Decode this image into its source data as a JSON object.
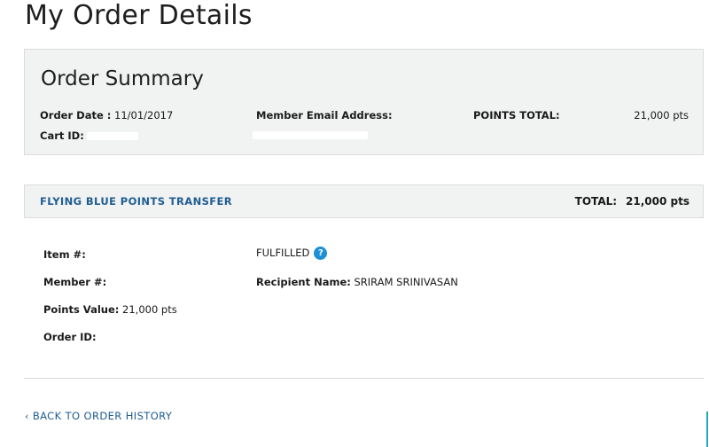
{
  "page": {
    "title": "My Order Details"
  },
  "summary": {
    "title": "Order Summary",
    "order_date_label": "Order Date :",
    "order_date_value": "11/01/2017",
    "cart_id_label": "Cart ID:",
    "member_email_label": "Member Email Address:",
    "points_total_label": "POINTS TOTAL:",
    "points_total_value": "21,000 pts"
  },
  "transfer": {
    "title": "FLYING BLUE POINTS TRANSFER",
    "total_label": "TOTAL:",
    "total_value": "21,000 pts"
  },
  "item": {
    "item_label": "Item #:",
    "member_label": "Member #:",
    "points_value_label": "Points Value:",
    "points_value": "21,000 pts",
    "order_id_label": "Order ID:",
    "status": "FULFILLED",
    "help_glyph": "?",
    "recipient_label": "Recipient Name:",
    "recipient_value": "SRIRAM SRINIVASAN"
  },
  "nav": {
    "back_label": "BACK TO ORDER HISTORY",
    "back_chevron": "‹"
  },
  "colors": {
    "link": "#1f5d91",
    "panel": "#f1f2f2",
    "help_icon": "#1d8fd6"
  }
}
